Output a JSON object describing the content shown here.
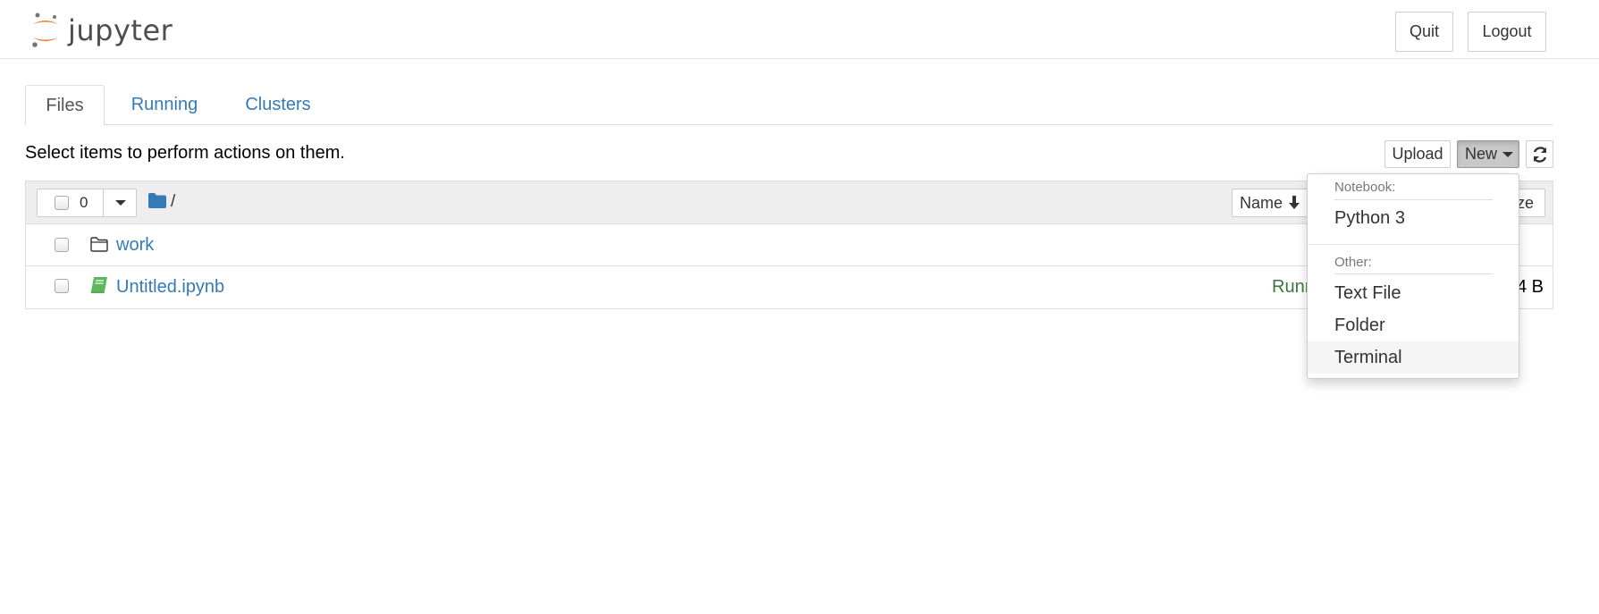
{
  "header": {
    "brand": "jupyter",
    "quit_label": "Quit",
    "logout_label": "Logout"
  },
  "tabs": [
    {
      "label": "Files",
      "active": true
    },
    {
      "label": "Running",
      "active": false
    },
    {
      "label": "Clusters",
      "active": false
    }
  ],
  "toolbar": {
    "hint": "Select items to perform actions on them.",
    "upload_label": "Upload",
    "new_label": "New",
    "refresh_icon": "refresh-icon"
  },
  "list_header": {
    "selected_count": "0",
    "breadcrumb": "/",
    "sort_name_label": "Name",
    "sort_size_label": "ze"
  },
  "files": [
    {
      "name": "work",
      "type": "folder",
      "status": "",
      "size": ""
    },
    {
      "name": "Untitled.ipynb",
      "type": "notebook",
      "status": "Runn",
      "size": "4 B"
    }
  ],
  "new_menu": {
    "notebook_header": "Notebook:",
    "python_label": "Python 3",
    "other_header": "Other:",
    "text_file_label": "Text File",
    "folder_label": "Folder",
    "terminal_label": "Terminal"
  },
  "colors": {
    "link": "#337ab7",
    "running": "#3c763d",
    "logo_orange": "#f37726",
    "folder_blue": "#337ab7",
    "notebook_green": "#5cb85c"
  }
}
